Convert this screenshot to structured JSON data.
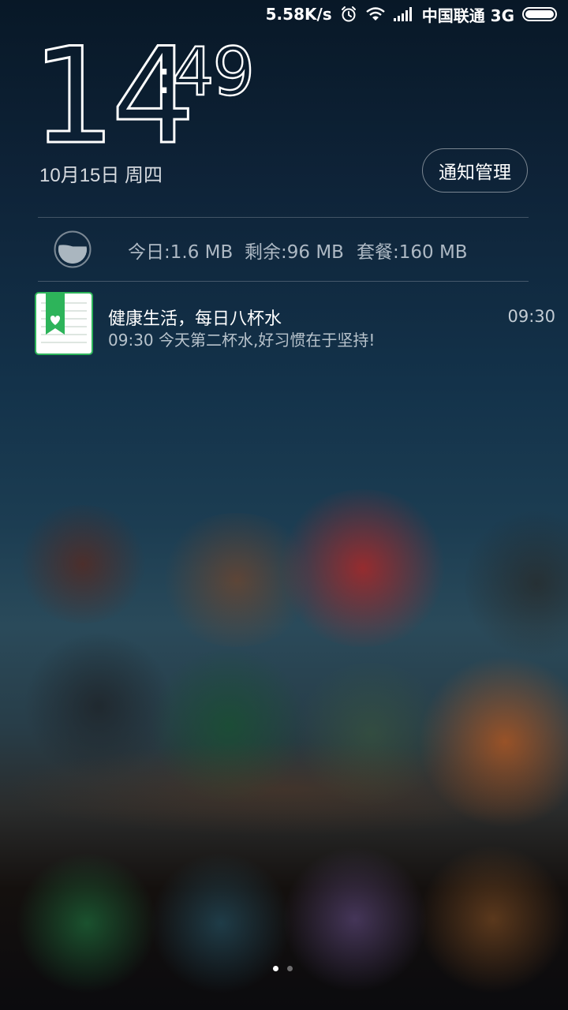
{
  "status_bar": {
    "speed": "5.58K/s",
    "carrier": "中国联通 3G",
    "icons": [
      "alarm-icon",
      "wifi-icon",
      "signal-icon",
      "battery-icon"
    ]
  },
  "clock": {
    "hour": "14",
    "minute": "49",
    "date": "10月15日 周四"
  },
  "notification_manage_label": "通知管理",
  "data_usage": {
    "today": "今日:1.6 MB",
    "remaining": "剩余:96 MB",
    "plan": "套餐:160 MB",
    "remaining_fraction": 0.6
  },
  "notification": {
    "title": "健康生活，每日八杯水",
    "body": "09:30 今天第二杯水,好习惯在于坚持!",
    "time": "09:30",
    "icon": "water-diary-app-icon"
  },
  "page_indicator": {
    "total": 2,
    "active": 1
  },
  "colors": {
    "app_icon_green": "#2db45a",
    "text_muted": "#aeb9c4"
  }
}
